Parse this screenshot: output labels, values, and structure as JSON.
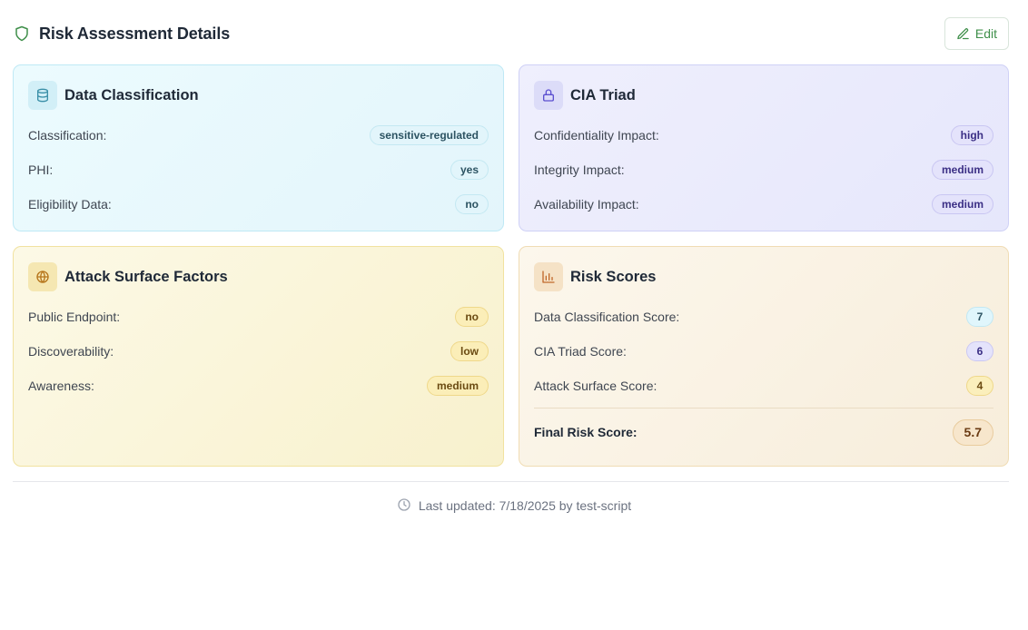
{
  "header": {
    "title": "Risk Assessment Details",
    "icon": "shield-icon",
    "edit_label": "Edit"
  },
  "cards": {
    "data_classification": {
      "title": "Data Classification",
      "icon": "database-icon",
      "rows": [
        {
          "label": "Classification:",
          "value": "sensitive-regulated"
        },
        {
          "label": "PHI:",
          "value": "yes"
        },
        {
          "label": "Eligibility Data:",
          "value": "no"
        }
      ]
    },
    "cia_triad": {
      "title": "CIA Triad",
      "icon": "lock-icon",
      "rows": [
        {
          "label": "Confidentiality Impact:",
          "value": "high"
        },
        {
          "label": "Integrity Impact:",
          "value": "medium"
        },
        {
          "label": "Availability Impact:",
          "value": "medium"
        }
      ]
    },
    "attack_surface": {
      "title": "Attack Surface Factors",
      "icon": "globe-icon",
      "rows": [
        {
          "label": "Public Endpoint:",
          "value": "no"
        },
        {
          "label": "Discoverability:",
          "value": "low"
        },
        {
          "label": "Awareness:",
          "value": "medium"
        }
      ]
    },
    "risk_scores": {
      "title": "Risk Scores",
      "icon": "bar-chart-icon",
      "rows": [
        {
          "label": "Data Classification Score:",
          "value": "7"
        },
        {
          "label": "CIA Triad Score:",
          "value": "6"
        },
        {
          "label": "Attack Surface Score:",
          "value": "4"
        }
      ],
      "final": {
        "label": "Final Risk Score:",
        "value": "5.7"
      }
    }
  },
  "footer": {
    "icon": "clock-icon",
    "text": "Last updated: 7/18/2025 by test-script"
  },
  "colors": {
    "accent_green": "#3f8f4a",
    "cyan_card": "#ecfbfe",
    "violet_card": "#efeffd",
    "yellow_card": "#fcf9e6",
    "peach_card": "#fcf7ec"
  }
}
